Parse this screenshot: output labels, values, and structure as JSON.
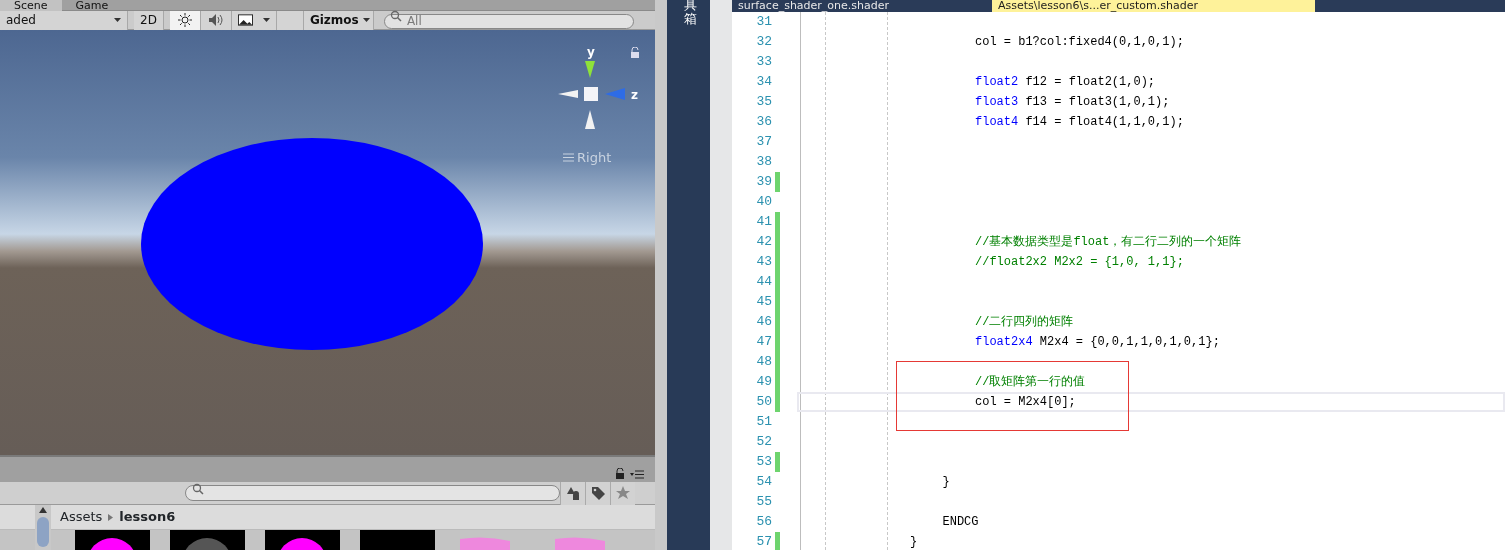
{
  "unity": {
    "tabs": [
      {
        "label": "Scene",
        "selected": true
      },
      {
        "label": "Game",
        "selected": false
      }
    ],
    "toolbar": {
      "shading": "aded",
      "mode_2d": "2D",
      "lighting_on": true,
      "gizmos": "Gizmos",
      "search_placeholder": "All"
    },
    "gizmo": {
      "y": "y",
      "z": "z",
      "view": "Right"
    },
    "project": {
      "breadcrumb": [
        "Assets",
        "lesson6"
      ],
      "thumbnails": [
        {
          "kind": "sphere",
          "color": "#ff00ff"
        },
        {
          "kind": "sphere",
          "color": "#555555"
        },
        {
          "kind": "sphere",
          "color": "#ff00ff"
        },
        {
          "kind": "blank",
          "color": "#000000"
        },
        {
          "kind": "file",
          "color": "#ee88dd"
        },
        {
          "kind": "file",
          "color": "#ee88dd"
        }
      ]
    }
  },
  "sidebar": {
    "label": "具箱"
  },
  "editor": {
    "tabs": [
      {
        "label": "surface_shader_one.shader",
        "selected": false
      },
      {
        "label": "Assets\\lesson6\\s...er_custom.shader",
        "selected": true
      }
    ],
    "code": {
      "children": [
        {
          "children": [
            {
              "lines": [
                {
                  "number": "31",
                  "changed": false
                },
                {
                  "number": "32",
                  "text": "col = b1?col:fixed4(0,1,0,1);",
                  "changed": false
                },
                {
                  "number": "33",
                  "changed": false
                },
                {
                  "number": "34",
                  "type": "float2",
                  "text": "f12 = float2(1,0);",
                  "changed": false
                },
                {
                  "number": "35",
                  "type": "float3",
                  "text": "f13 = float3(1,0,1);",
                  "changed": false
                },
                {
                  "number": "36",
                  "type": "float4",
                  "text": "f14 = float4(1,1,0,1);",
                  "changed": false
                },
                {
                  "number": "37",
                  "changed": false
                },
                {
                  "number": "38",
                  "changed": false
                },
                {
                  "number": "39",
                  "changed": true
                },
                {
                  "number": "40",
                  "changed": false
                },
                {
                  "number": "41",
                  "changed": true
                },
                {
                  "number": "42",
                  "kind": "comment",
                  "text": "//基本数据类型是float，有二行二列的一个矩阵",
                  "changed": true
                },
                {
                  "number": "43",
                  "kind": "comment",
                  "text": "//float2x2 M2x2 = {1,0, 1,1};",
                  "changed": true
                },
                {
                  "number": "44",
                  "changed": true
                },
                {
                  "number": "45",
                  "changed": true
                },
                {
                  "number": "46",
                  "kind": "comment",
                  "text": "//二行四列的矩阵",
                  "changed": true
                },
                {
                  "number": "47",
                  "type": "float2x4",
                  "text": "M2x4 = {0,0,1,1,0,1,0,1};",
                  "changed": true
                },
                {
                  "number": "48",
                  "changed": true
                },
                {
                  "number": "49",
                  "kind": "comment",
                  "text": "//取矩阵第一行的值",
                  "changed": true
                },
                {
                  "number": "50",
                  "text": "col = M2x4[0];",
                  "changed": true,
                  "current": true
                },
                {
                  "number": "51",
                  "changed": false
                },
                {
                  "number": "52",
                  "changed": false
                },
                {
                  "number": "53",
                  "changed": true
                }
              ]
            }
          ],
          "lines": [
            {
              "number": "54",
              "text": "}",
              "changed": false
            },
            {
              "number": "55",
              "changed": false
            },
            {
              "number": "56",
              "text": "ENDCG",
              "changed": false
            }
          ]
        }
      ],
      "lines": [
        {
          "number": "57",
          "text": "}",
          "changed": true
        }
      ]
    }
  }
}
